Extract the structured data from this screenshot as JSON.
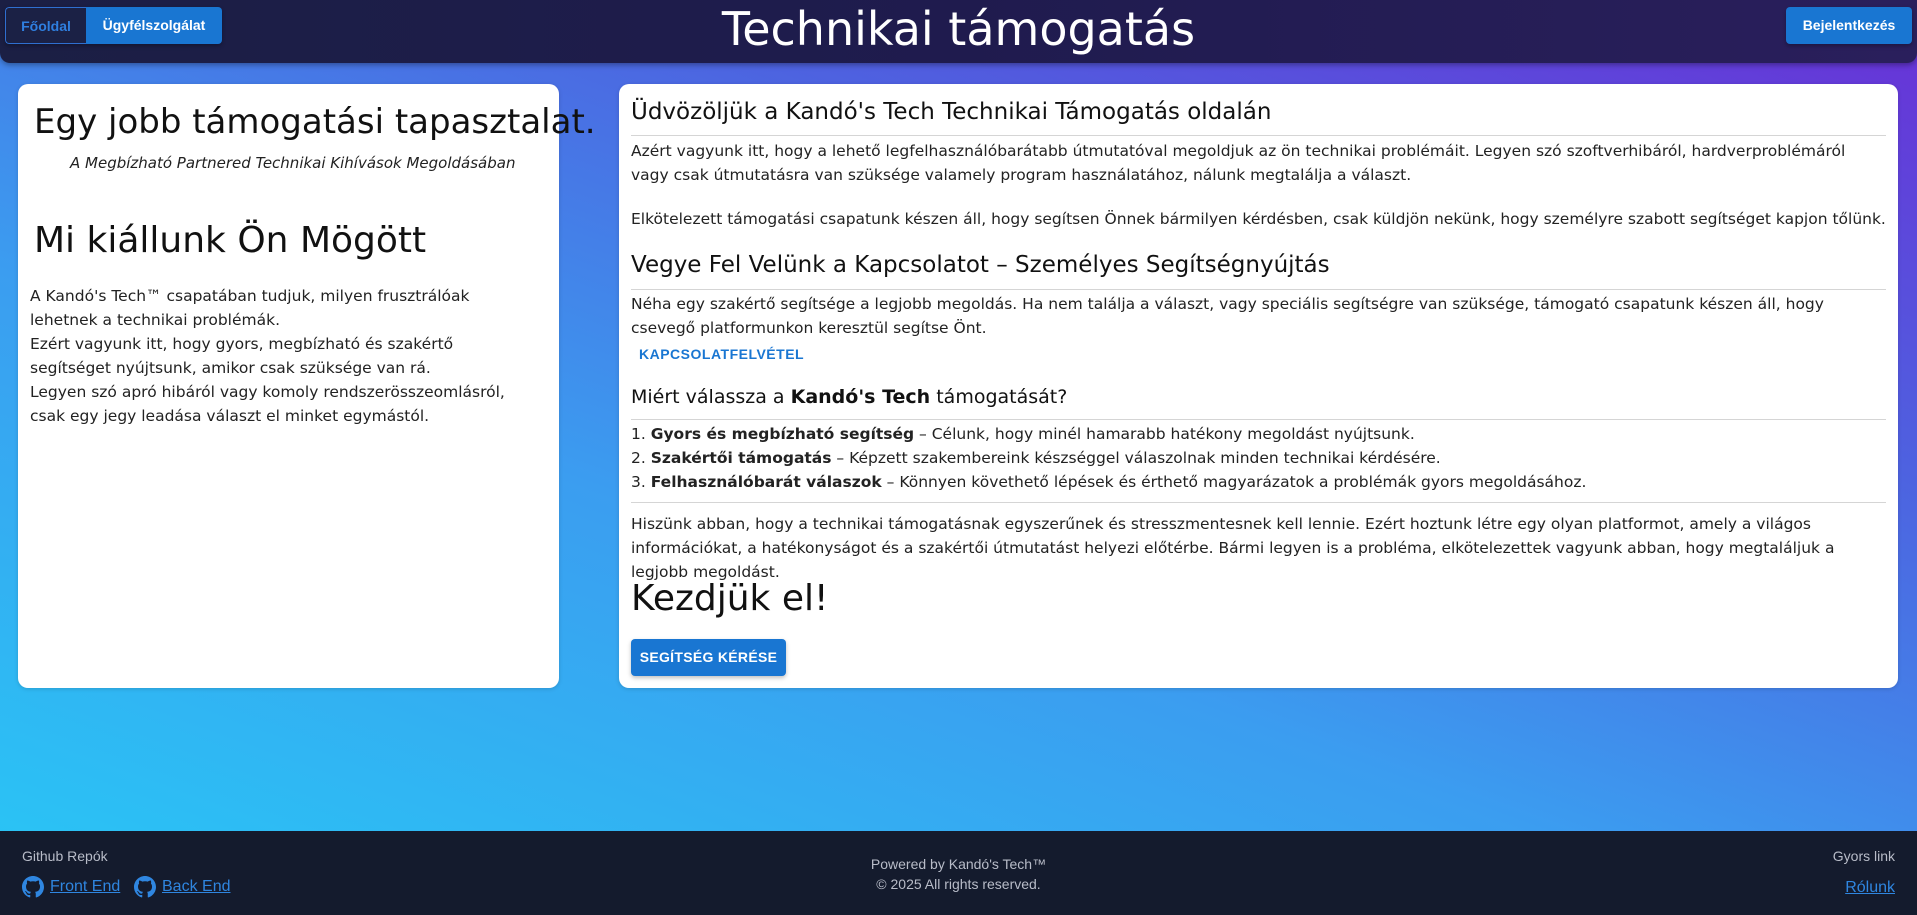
{
  "header": {
    "nav": {
      "home": "Főoldal",
      "support": "Ügyfélszolgálat"
    },
    "title": "Technikai támogatás",
    "login": "Bejelentkezés"
  },
  "left": {
    "title": "Egy jobb támogatási tapasztalat.",
    "subtitle": "A Megbízható Partnered Technikai Kihívások Megoldásában",
    "heading": "Mi kiállunk Ön Mögött",
    "paragraphs": [
      "A Kandó's Tech™ csapatában tudjuk, milyen frusztrálóak lehetnek a technikai problémák.",
      "Ezért vagyunk itt, hogy gyors, megbízható és szakértő segítséget nyújtsunk, amikor csak szüksége van rá.",
      "Legyen szó apró hibáról vagy komoly rendszerösszeomlásról, csak egy jegy leadása választ el minket egymástól."
    ]
  },
  "right": {
    "welcome_title": "Üdvözöljük a Kandó's Tech Technikai Támogatás oldalán",
    "welcome_p1": "Azért vagyunk itt, hogy a lehető legfelhasználóbarátabb útmutatóval megoldjuk az ön technikai problémáit. Legyen szó szoftverhibáról, hardverproblémáról vagy csak útmutatásra van szüksége valamely program használatához, nálunk megtalálja a választ.",
    "welcome_p2": "Elkötelezett támogatási csapatunk készen áll, hogy segítsen Önnek bármilyen kérdésben, csak küldjön nekünk, hogy személyre szabott segítséget kapjon tőlünk.",
    "contact_title": "Vegye Fel Velünk a Kapcsolatot – Személyes Segítségnyújtás",
    "contact_p": "Néha egy szakértő segítsége a legjobb megoldás. Ha nem találja a választ, vagy speciális segítségre van szüksége, támogató csapatunk készen áll, hogy csevegő platformunkon keresztül segítse Önt.",
    "contact_link": "KAPCSOLATFELVÉTEL",
    "why_prefix": "Miért válassza a ",
    "why_brand": "Kandó's Tech",
    "why_suffix": " támogatását?",
    "reasons": [
      {
        "num": "1. ",
        "bold": "Gyors és megbízható segítség",
        "text": " – Célunk, hogy minél hamarabb hatékony megoldást nyújtsunk."
      },
      {
        "num": "2. ",
        "bold": "Szakértői támogatás",
        "text": " – Képzett szakembereink készséggel válaszolnak minden technikai kérdésére."
      },
      {
        "num": "3. ",
        "bold": "Felhasználóbarát válaszok",
        "text": " – Könnyen követhető lépések és érthető magyarázatok a problémák gyors megoldásához."
      }
    ],
    "closing_p": "Hiszünk abban, hogy a technikai támogatásnak egyszerűnek és stresszmentesnek kell lennie. Ezért hoztunk létre egy olyan platformot, amely a világos információkat, a hatékonyságot és a szakértői útmutatást helyezi előtérbe. Bármi legyen is a probléma, elkötelezettek vagyunk abban, hogy megtaláljuk a legjobb megoldást.",
    "cta_title": "Kezdjük el!",
    "cta_button": "SEGÍTSÉG KÉRÉSE"
  },
  "footer": {
    "repos_title": "Github Repók",
    "repo_front": "Front End",
    "repo_back": "Back End",
    "powered": "Powered by Kandó's Tech™",
    "copyright": "© 2025 All rights reserved.",
    "quick_title": "Gyors link",
    "about": "Rólunk"
  },
  "colors": {
    "primary": "#1976d2",
    "header_bg": "#1f1b4e",
    "footer_bg": "#141b2d"
  },
  "icons": {
    "repo_link": "github-icon"
  }
}
